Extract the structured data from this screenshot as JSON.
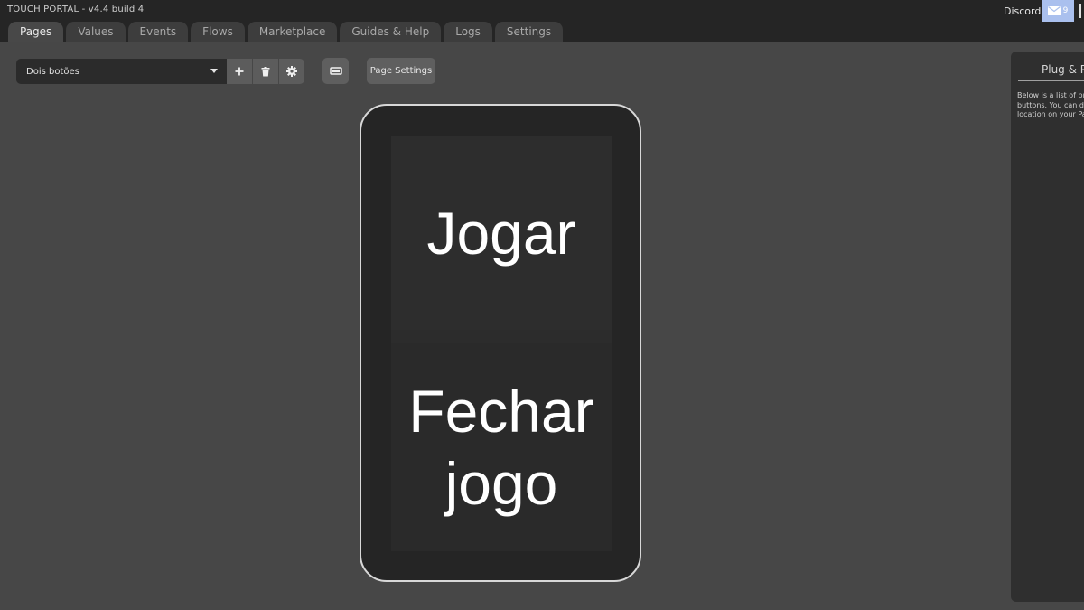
{
  "app": {
    "title": "TOUCH PORTAL - v4.4 build 4",
    "discord_label": "Discord",
    "mail_count": "9",
    "accent_color": "#aac0ee"
  },
  "tabs": [
    {
      "label": "Pages",
      "active": true
    },
    {
      "label": "Values",
      "active": false
    },
    {
      "label": "Events",
      "active": false
    },
    {
      "label": "Flows",
      "active": false
    },
    {
      "label": "Marketplace",
      "active": false
    },
    {
      "label": "Guides & Help",
      "active": false
    },
    {
      "label": "Logs",
      "active": false
    },
    {
      "label": "Settings",
      "active": false
    }
  ],
  "toolbar": {
    "page_select_value": "Dois botões",
    "add_icon": "plus-icon",
    "delete_icon": "trash-icon",
    "settings_icon": "gear-icon",
    "orientation_icon": "rotate-device-icon",
    "page_settings_label": "Page Settings"
  },
  "device": {
    "buttons": [
      {
        "line1": "Jogar",
        "line2": ""
      },
      {
        "line1": "Fechar",
        "line2": "jogo"
      }
    ]
  },
  "right_panel": {
    "title": "Plug & Pl",
    "description_lines": [
      "Below is a list of pre",
      "buttons. You can dra",
      "location on your Pag"
    ]
  }
}
